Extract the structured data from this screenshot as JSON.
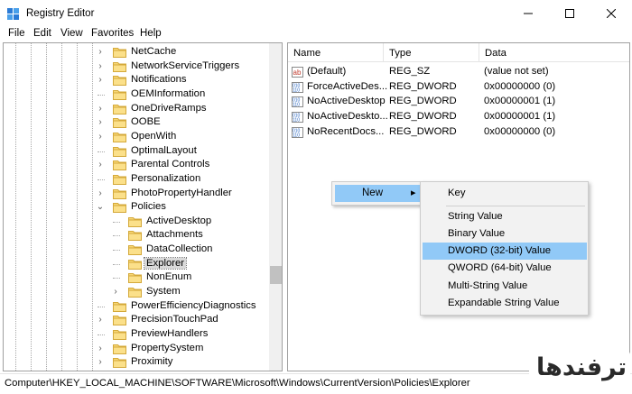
{
  "window": {
    "title": "Registry Editor"
  },
  "menu": [
    "File",
    "Edit",
    "View",
    "Favorites",
    "Help"
  ],
  "tree": [
    {
      "label": "NetCache",
      "level": 0,
      "expander": "collapsed"
    },
    {
      "label": "NetworkServiceTriggers",
      "level": 0,
      "expander": "collapsed"
    },
    {
      "label": "Notifications",
      "level": 0,
      "expander": "collapsed"
    },
    {
      "label": "OEMInformation",
      "level": 0,
      "expander": "none"
    },
    {
      "label": "OneDriveRamps",
      "level": 0,
      "expander": "collapsed"
    },
    {
      "label": "OOBE",
      "level": 0,
      "expander": "collapsed"
    },
    {
      "label": "OpenWith",
      "level": 0,
      "expander": "collapsed"
    },
    {
      "label": "OptimalLayout",
      "level": 0,
      "expander": "none"
    },
    {
      "label": "Parental Controls",
      "level": 0,
      "expander": "collapsed"
    },
    {
      "label": "Personalization",
      "level": 0,
      "expander": "none"
    },
    {
      "label": "PhotoPropertyHandler",
      "level": 0,
      "expander": "collapsed"
    },
    {
      "label": "Policies",
      "level": 0,
      "expander": "expanded"
    },
    {
      "label": "ActiveDesktop",
      "level": 1,
      "expander": "none"
    },
    {
      "label": "Attachments",
      "level": 1,
      "expander": "none"
    },
    {
      "label": "DataCollection",
      "level": 1,
      "expander": "none"
    },
    {
      "label": "Explorer",
      "level": 1,
      "expander": "none",
      "selected": true
    },
    {
      "label": "NonEnum",
      "level": 1,
      "expander": "none"
    },
    {
      "label": "System",
      "level": 1,
      "expander": "collapsed"
    },
    {
      "label": "PowerEfficiencyDiagnostics",
      "level": 0,
      "expander": "none"
    },
    {
      "label": "PrecisionTouchPad",
      "level": 0,
      "expander": "collapsed"
    },
    {
      "label": "PreviewHandlers",
      "level": 0,
      "expander": "none"
    },
    {
      "label": "PropertySystem",
      "level": 0,
      "expander": "collapsed"
    },
    {
      "label": "Proximity",
      "level": 0,
      "expander": "collapsed"
    }
  ],
  "list": {
    "columns": [
      "Name",
      "Type",
      "Data"
    ],
    "rows": [
      {
        "name": "(Default)",
        "type": "REG_SZ",
        "data": "(value not set)",
        "icon": "string-value-icon"
      },
      {
        "name": "ForceActiveDes...",
        "type": "REG_DWORD",
        "data": "0x00000000 (0)",
        "icon": "binary-value-icon"
      },
      {
        "name": "NoActiveDesktop",
        "type": "REG_DWORD",
        "data": "0x00000001 (1)",
        "icon": "binary-value-icon"
      },
      {
        "name": "NoActiveDeskto...",
        "type": "REG_DWORD",
        "data": "0x00000001 (1)",
        "icon": "binary-value-icon"
      },
      {
        "name": "NoRecentDocs...",
        "type": "REG_DWORD",
        "data": "0x00000000 (0)",
        "icon": "binary-value-icon"
      }
    ]
  },
  "context_menu": {
    "new_label": "New",
    "submenu": [
      {
        "label": "Key"
      },
      {
        "label": "String Value"
      },
      {
        "label": "Binary Value"
      },
      {
        "label": "DWORD (32-bit) Value",
        "highlighted": true
      },
      {
        "label": "QWORD (64-bit) Value"
      },
      {
        "label": "Multi-String Value"
      },
      {
        "label": "Expandable String Value"
      }
    ]
  },
  "status": {
    "path": "Computer\\HKEY_LOCAL_MACHINE\\SOFTWARE\\Microsoft\\Windows\\CurrentVersion\\Policies\\Explorer"
  },
  "watermark": {
    "text": "ترفندها"
  },
  "colors": {
    "highlight": "#91c9f7",
    "folder": "#f8d775",
    "selection": "#d9d9d9"
  }
}
